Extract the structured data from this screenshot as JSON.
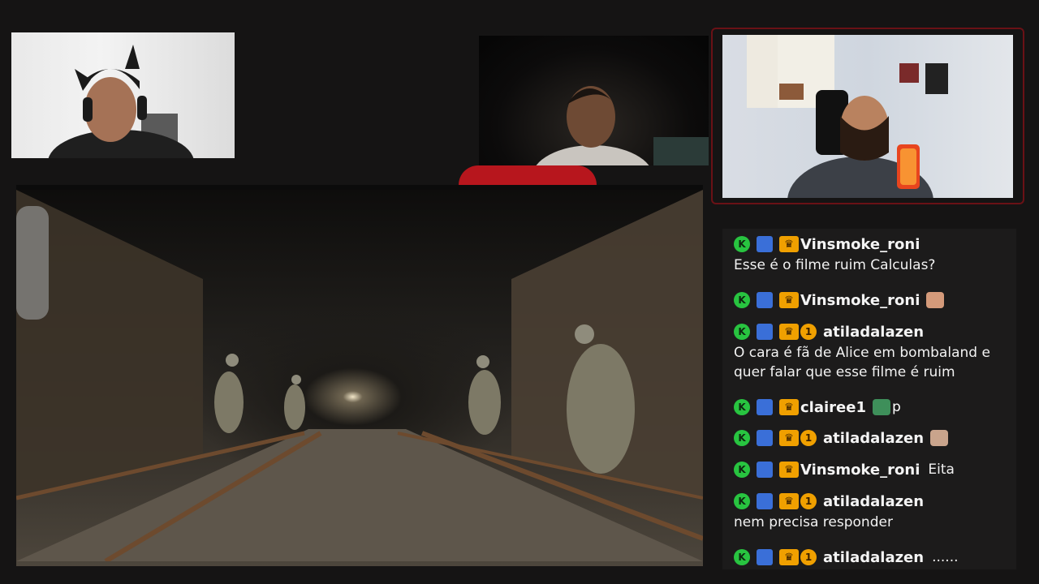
{
  "chat": {
    "messages": [
      {
        "user": "Vinsmoke_roni",
        "badges": [
          "k",
          "sub",
          "crown"
        ],
        "tail": "",
        "text": "Esse é o filme ruim Calculas?"
      },
      {
        "user": "Vinsmoke_roni",
        "badges": [
          "k",
          "sub",
          "crown"
        ],
        "tail": "",
        "emote": "face-emote",
        "text": ""
      },
      {
        "user": "atiladalazen",
        "badges": [
          "k",
          "sub",
          "crown",
          "1"
        ],
        "tail": "",
        "text_lines": [
          "O cara é fã de Alice em bombaland e",
          "quer falar que esse filme é ruim"
        ]
      },
      {
        "user": "clairee1",
        "badges": [
          "k",
          "sub",
          "crown"
        ],
        "tail": "p",
        "emote": "turtle-emote",
        "text": ""
      },
      {
        "user": "atiladalazen",
        "badges": [
          "k",
          "sub",
          "crown",
          "1"
        ],
        "tail": "",
        "emote": "bald-emote",
        "text": ""
      },
      {
        "user": "Vinsmoke_roni",
        "badges": [
          "k",
          "sub",
          "crown"
        ],
        "tail": "Eita",
        "text": ""
      },
      {
        "user": "atiladalazen",
        "badges": [
          "k",
          "sub",
          "crown",
          "1"
        ],
        "tail": "",
        "text": "nem precisa responder"
      },
      {
        "user": "atiladalazen",
        "badges": [
          "k",
          "sub",
          "crown",
          "1"
        ],
        "tail": "......",
        "text": ""
      }
    ]
  },
  "badges": {
    "k_label": "K",
    "one_label": "1",
    "crown_symbol": "♛"
  },
  "colors": {
    "accent_red": "#b7161d",
    "kick_green": "#28c440",
    "crown_gold": "#f0a000"
  }
}
